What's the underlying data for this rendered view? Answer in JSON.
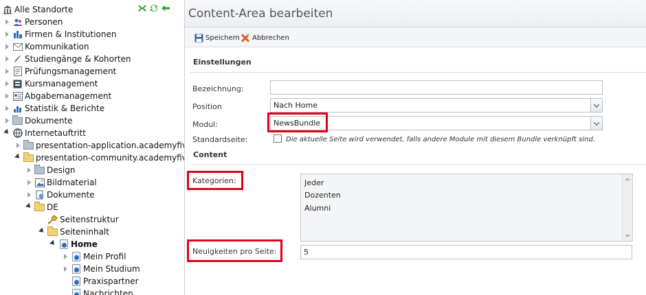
{
  "tree": {
    "root_label": "Alle Standorte",
    "items": [
      {
        "label": "Personen",
        "icon": "people-icon",
        "arrow": "right",
        "level": 0
      },
      {
        "label": "Firmen & Institutionen",
        "icon": "company-icon",
        "arrow": "right",
        "level": 0
      },
      {
        "label": "Kommunikation",
        "icon": "mail-icon",
        "arrow": "right",
        "level": 0
      },
      {
        "label": "Studiengänge & Kohorten",
        "icon": "feather-icon",
        "arrow": "right",
        "level": 0
      },
      {
        "label": "Prüfungsmanagement",
        "icon": "exam-icon",
        "arrow": "right",
        "level": 0
      },
      {
        "label": "Kursmanagement",
        "icon": "course-icon",
        "arrow": "right",
        "level": 0
      },
      {
        "label": "Abgabemanagement",
        "icon": "submission-icon",
        "arrow": "right",
        "level": 0
      },
      {
        "label": "Statistik & Berichte",
        "icon": "chart-icon",
        "arrow": "right",
        "level": 0
      },
      {
        "label": "Dokumente",
        "icon": "folder-icon",
        "arrow": "right",
        "level": 0
      },
      {
        "label": "Internetauftritt",
        "icon": "globe-icon",
        "arrow": "down",
        "level": 0
      },
      {
        "label": "presentation-application.academyfiv",
        "icon": "folder-icon",
        "arrow": "right",
        "level": 1
      },
      {
        "label": "presentation-community.academyfiv",
        "icon": "folder-open-icon",
        "arrow": "down",
        "level": 1
      },
      {
        "label": "Design",
        "icon": "folder-icon",
        "arrow": "right",
        "level": 2
      },
      {
        "label": "Bildmaterial",
        "icon": "image-icon",
        "arrow": "right",
        "level": 2
      },
      {
        "label": "Dokumente",
        "icon": "document-icon",
        "arrow": "right",
        "level": 2
      },
      {
        "label": "DE",
        "icon": "folder-open-icon",
        "arrow": "down",
        "level": 2
      },
      {
        "label": "Seitenstruktur",
        "icon": "key-icon",
        "arrow": "none",
        "level": 3
      },
      {
        "label": "Seiteninhalt",
        "icon": "folder-open-icon",
        "arrow": "down",
        "level": 3
      },
      {
        "label": "Home",
        "icon": "page-icon",
        "arrow": "down",
        "level": 4,
        "bold": true
      },
      {
        "label": "Mein Profil",
        "icon": "page-icon",
        "arrow": "right",
        "level": 5
      },
      {
        "label": "Mein Studium",
        "icon": "page-icon",
        "arrow": "right",
        "level": 5
      },
      {
        "label": "Praxispartner",
        "icon": "page-icon",
        "arrow": "none",
        "level": 5
      },
      {
        "label": "Nachrichten",
        "icon": "page-icon",
        "arrow": "none",
        "level": 5
      }
    ]
  },
  "editor": {
    "title": "Content-Area bearbeiten",
    "save_label": "Speichern",
    "cancel_label": "Abbrechen",
    "section_settings": "Einstellungen",
    "label_bezeichnung": "Bezeichnung:",
    "value_bezeichnung": "",
    "label_position": "Position",
    "value_position": "Nach Home",
    "label_modul": "Modul:",
    "value_modul": "NewsBundle",
    "label_standardseite": "Standardseite:",
    "standardseite_desc": "Die aktuelle Seite wird verwendet, falls andere Module mit diesem Bundle verknüpft sind.",
    "section_content": "Content",
    "label_kategorien": "Kategorien:",
    "kategorien": [
      "Jeder",
      "Dozenten",
      "Alumni"
    ],
    "label_neuigkeiten": "Neuigkeiten pro Seite:",
    "value_neuigkeiten": "5"
  },
  "colors": {
    "highlight": "#e3001b",
    "accent": "#2c6fb7"
  }
}
